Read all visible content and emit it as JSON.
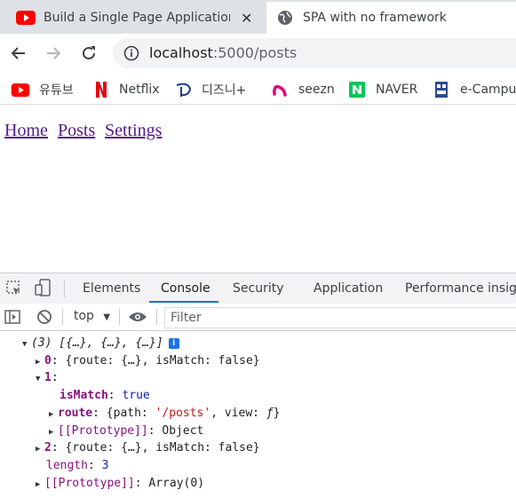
{
  "browser": {
    "tabs": [
      {
        "title": "Build a Single Page Application",
        "active": false
      },
      {
        "title": "SPA with no framework",
        "active": true
      }
    ],
    "address": {
      "host": "localhost",
      "path": ":5000/posts"
    },
    "bookmarks": [
      "유튜브",
      "Netflix",
      "디즈니+",
      "seezn",
      "NAVER",
      "e-Campus"
    ]
  },
  "page": {
    "nav_links": [
      "Home",
      "Posts",
      "Settings"
    ]
  },
  "devtools": {
    "tabs": [
      "Elements",
      "Console",
      "Security",
      "Application",
      "Performance insights"
    ],
    "active_tab": "Console",
    "context": "top",
    "filter_placeholder": "Filter",
    "console": {
      "summary": "(3) [{…}, {…}, {…}]",
      "item0_label": "0",
      "item0_value": "{route: {…}, isMatch: false}",
      "item1_label": "1",
      "ismatch_key": "isMatch",
      "ismatch_value": "true",
      "route_key": "route",
      "route_open": "{path: ",
      "route_path": "'/posts'",
      "route_view_key": ", view: ",
      "route_view_value": "ƒ",
      "route_close": "}",
      "proto_obj_key": "[[Prototype]]",
      "proto_obj_value": "Object",
      "item2_label": "2",
      "item2_value": "{route: {…}, isMatch: false}",
      "length_key": "length",
      "length_value": "3",
      "proto_arr_key": "[[Prototype]]",
      "proto_arr_value": "Array(0)"
    }
  }
}
